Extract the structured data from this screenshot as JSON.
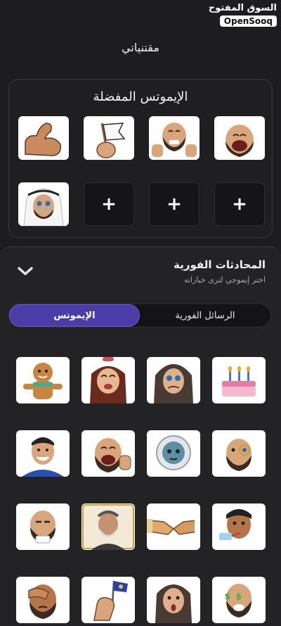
{
  "watermark": {
    "arabic": "السوق المفتوح",
    "english": "OpenSooq"
  },
  "page": {
    "title": "مقتنياتي"
  },
  "favorites": {
    "title": "الإيموتس المفضلة",
    "items": [
      {
        "icon": "laughing-man-emoji",
        "empty": false
      },
      {
        "icon": "thumbs-up-man-emoji",
        "empty": false
      },
      {
        "icon": "white-flag-emoji",
        "empty": false
      },
      {
        "icon": "flexed-biceps-emoji",
        "empty": false
      },
      {
        "icon": "plus-icon",
        "empty": true,
        "label": "+"
      },
      {
        "icon": "plus-icon",
        "empty": true,
        "label": "+"
      },
      {
        "icon": "plus-icon",
        "empty": true,
        "label": "+"
      },
      {
        "icon": "crying-man-ghutra-emoji",
        "empty": false
      }
    ]
  },
  "sheet": {
    "title": "المحادثات الفورية",
    "subtitle": "اختر إيموجي لترى خياراته",
    "tabs": {
      "instant_messages": "الرسائل الفورية",
      "emotes": "الإيموتس"
    },
    "active_tab": "emotes",
    "emotes": [
      "birthday-cake-emoji",
      "crying-woman-hijab-emoji",
      "laughing-girl-emoji",
      "gingerbread-man-emoji",
      "monocle-man-emoji",
      "astronaut-emoji",
      "facepalm-laughing-man-emoji",
      "smiling-man-emoji",
      "drinking-man-emoji",
      "handshake-emoji",
      "old-man-portrait-emoji",
      "tea-man-emoji",
      "money-eyes-man-emoji",
      "shocked-woman-emoji",
      "fist-flag-emoji",
      "facepalm-man-emoji"
    ]
  },
  "colors": {
    "background": "#1d1d1f",
    "accent": "#4b3ca7",
    "skin": "#d9a57a",
    "beard": "#3b2a20"
  }
}
